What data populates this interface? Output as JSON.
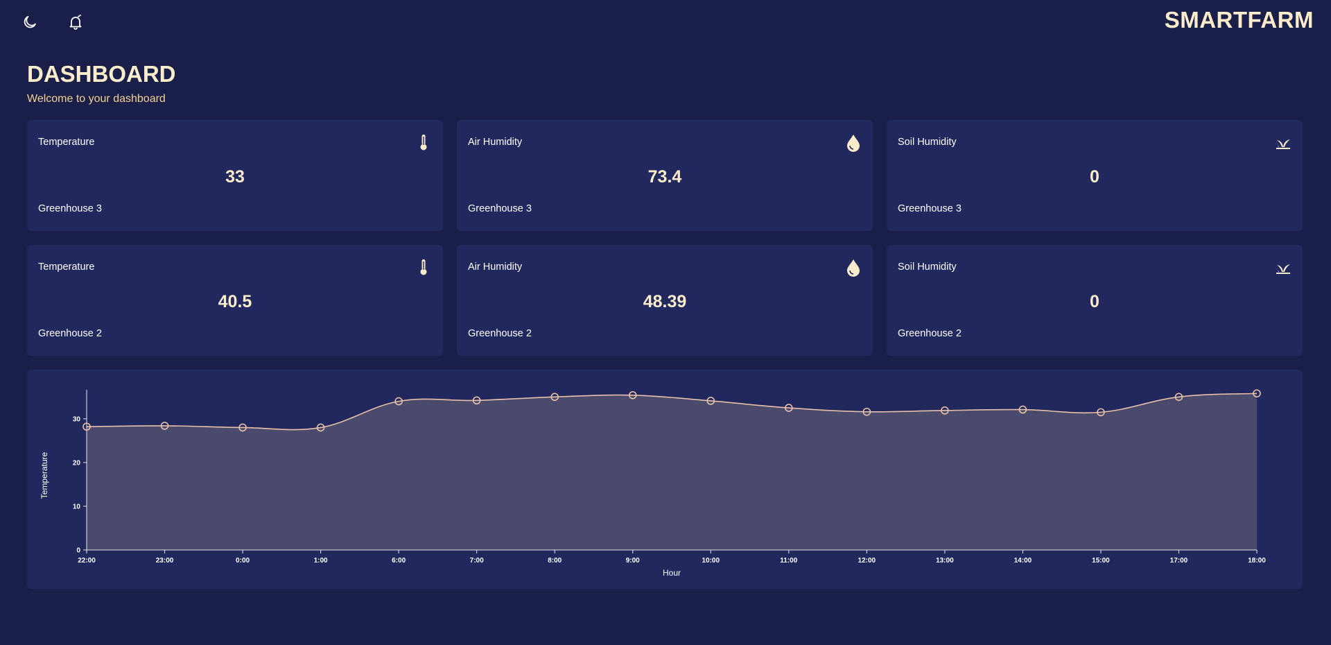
{
  "header": {
    "brand": "SMARTFARM",
    "icons": [
      "moon-icon",
      "bell-icon"
    ]
  },
  "page": {
    "title": "DASHBOARD",
    "subtitle": "Welcome to your dashboard"
  },
  "colors": {
    "background": "#1a1f49",
    "card": "#20285d",
    "accent": "#fbeccb",
    "subtitle": "#f2d394",
    "chart_line": "#e9c0a8",
    "chart_fill": "#4a4a6d"
  },
  "cards": [
    {
      "title": "Temperature",
      "value": "33",
      "location": "Greenhouse 3",
      "icon": "thermometer-icon"
    },
    {
      "title": "Air Humidity",
      "value": "73.4",
      "location": "Greenhouse 3",
      "icon": "droplet-icon"
    },
    {
      "title": "Soil Humidity",
      "value": "0",
      "location": "Greenhouse 3",
      "icon": "soil-sprout-icon"
    },
    {
      "title": "Temperature",
      "value": "40.5",
      "location": "Greenhouse 2",
      "icon": "thermometer-icon"
    },
    {
      "title": "Air Humidity",
      "value": "48.39",
      "location": "Greenhouse 2",
      "icon": "droplet-icon"
    },
    {
      "title": "Soil Humidity",
      "value": "0",
      "location": "Greenhouse 2",
      "icon": "soil-sprout-icon"
    }
  ],
  "chart_data": {
    "type": "area",
    "title": "",
    "xlabel": "Hour",
    "ylabel": "Temperature",
    "categories": [
      "22:00",
      "23:00",
      "0:00",
      "1:00",
      "6:00",
      "7:00",
      "8:00",
      "9:00",
      "10:00",
      "11:00",
      "12:00",
      "13:00",
      "14:00",
      "15:00",
      "17:00",
      "18:00"
    ],
    "series": [
      {
        "values": [
          28.2,
          28.4,
          28.0,
          28.0,
          34.0,
          34.2,
          35.0,
          35.4,
          34.1,
          32.5,
          31.6,
          31.9,
          32.1,
          31.5,
          35.0,
          35.8
        ]
      }
    ],
    "yticks": [
      0,
      10,
      20,
      30
    ],
    "ylim": [
      0,
      36
    ],
    "grid": false,
    "legend": "none"
  }
}
